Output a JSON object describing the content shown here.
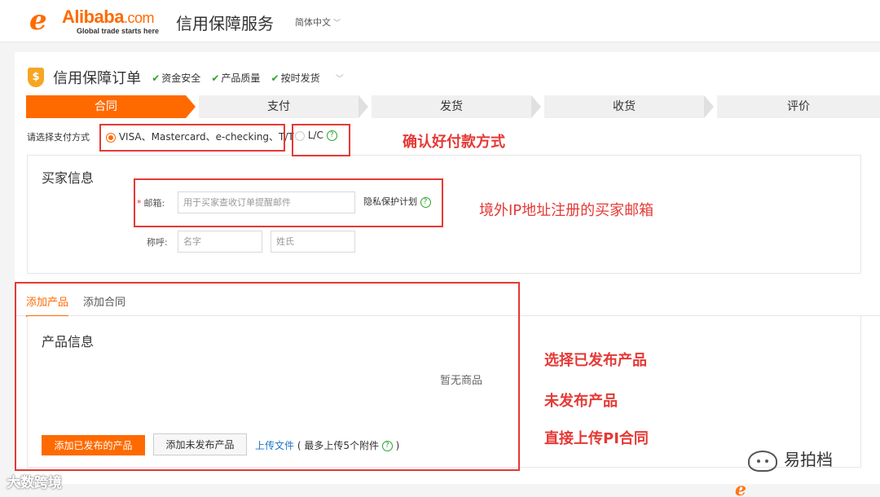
{
  "header": {
    "logo_word": "Alibaba",
    "logo_com": ".com",
    "logo_tagline": "Global trade starts here",
    "site_title": "信用保障服务",
    "language": "简体中文"
  },
  "order": {
    "title": "信用保障订单",
    "guarantees": [
      "资金安全",
      "产品质量",
      "按时发货"
    ]
  },
  "steps": [
    {
      "label": "合同",
      "active": true
    },
    {
      "label": "支付",
      "active": false
    },
    {
      "label": "发货",
      "active": false
    },
    {
      "label": "收货",
      "active": false
    },
    {
      "label": "评价",
      "active": false
    }
  ],
  "payment": {
    "label": "请选择支付方式",
    "option1": "VISA、Mastercard、e-checking、T/T",
    "option2": "L/C",
    "selected": "option1"
  },
  "buyer": {
    "title": "买家信息",
    "email_label": "邮箱:",
    "email_placeholder": "用于买家查收订单提醒邮件",
    "privacy": "隐私保护计划",
    "name_label": "称呼:",
    "first_name_placeholder": "名字",
    "last_name_placeholder": "姓氏"
  },
  "tabs": [
    {
      "label": "添加产品",
      "active": true
    },
    {
      "label": "添加合同",
      "active": false
    }
  ],
  "product": {
    "title": "产品信息",
    "empty": "暂无商品",
    "add_published": "添加已发布的产品",
    "add_unpublished": "添加未发布产品",
    "upload_link": "上传文件",
    "upload_note_open": "( 最多上传5个附件",
    "upload_note_close": ")"
  },
  "annotations": {
    "confirm_payment": "确认好付款方式",
    "overseas_email": "境外IP地址注册的买家邮箱",
    "select_published": "选择已发布产品",
    "unpublished": "未发布产品",
    "upload_pi": "直接上传PI合同"
  },
  "watermark": {
    "left": "大数跨境",
    "right": "易拍档"
  },
  "colors": {
    "accent": "#ff6a00",
    "annotation": "#e53935",
    "check": "#2aa52a",
    "link": "#1a73c8"
  }
}
